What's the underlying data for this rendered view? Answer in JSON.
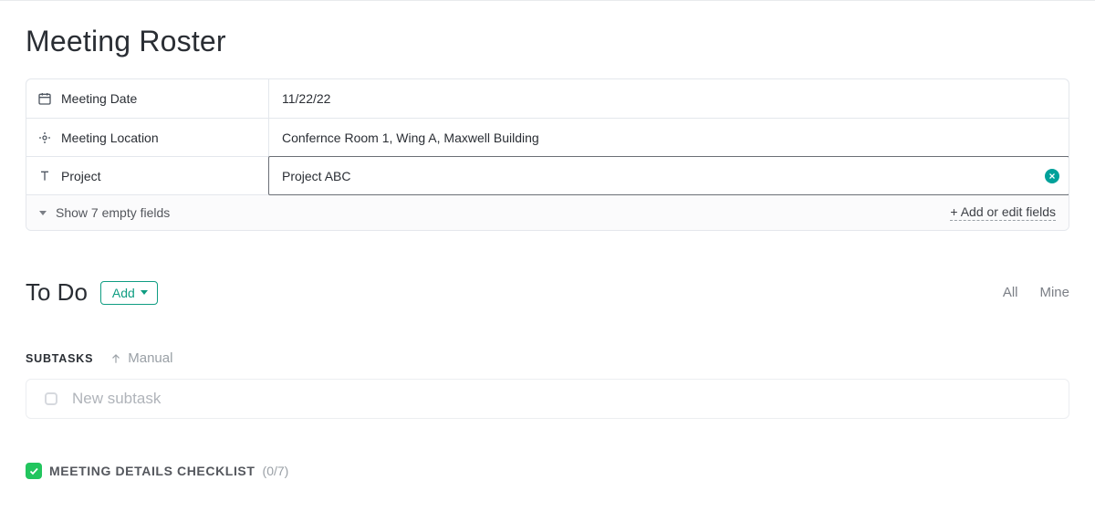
{
  "page_title": "Meeting Roster",
  "fields": {
    "date": {
      "label": "Meeting Date",
      "value": "11/22/22"
    },
    "location": {
      "label": "Meeting Location",
      "value": "Confernce Room 1, Wing A, Maxwell Building"
    },
    "project": {
      "label": "Project",
      "value": "Project ABC"
    }
  },
  "fields_footer": {
    "show_empty": "Show 7 empty fields",
    "add_edit": "+ Add or edit fields"
  },
  "todo": {
    "title": "To Do",
    "add_label": "Add",
    "filters": {
      "all": "All",
      "mine": "Mine"
    }
  },
  "subtasks": {
    "label": "SUBTASKS",
    "sort_label": "Manual",
    "new_placeholder": "New subtask"
  },
  "checklist": {
    "title": "MEETING DETAILS CHECKLIST",
    "count": "(0/7)"
  }
}
